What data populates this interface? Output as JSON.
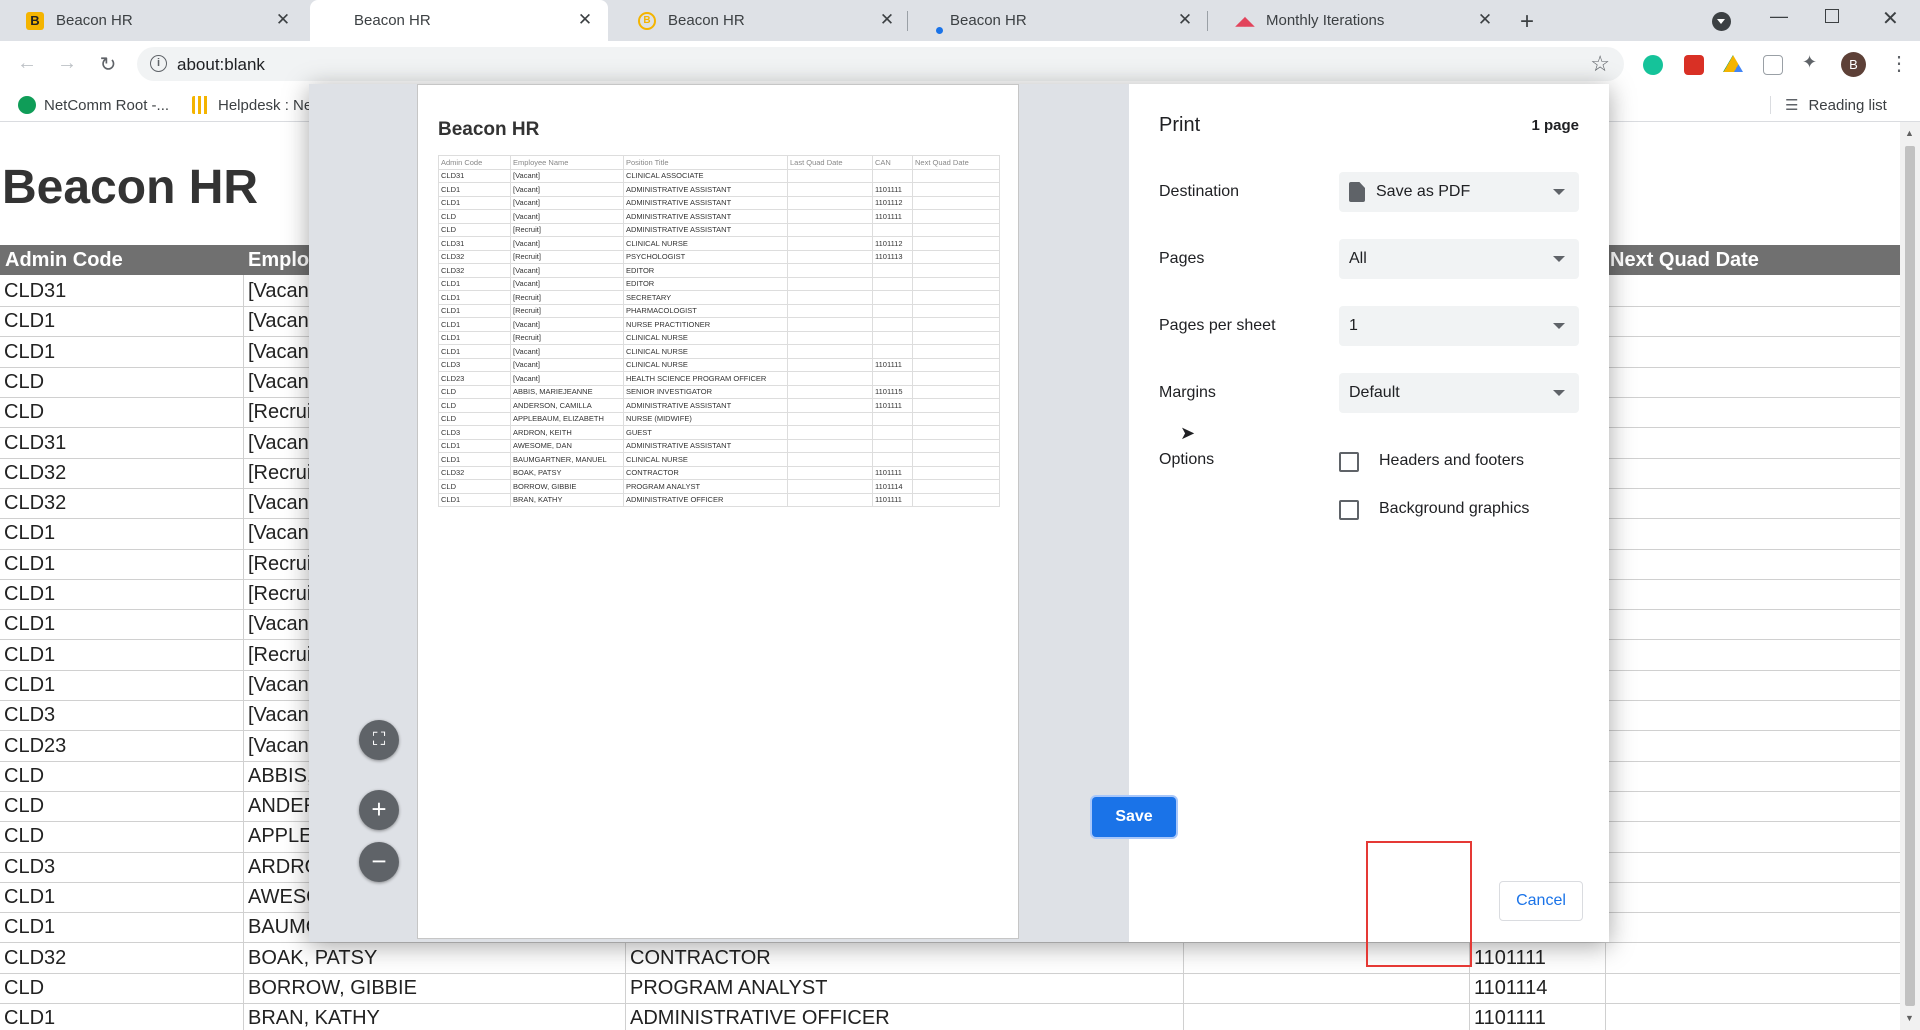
{
  "tabs": [
    {
      "title": "Beacon HR",
      "favicon": "B"
    },
    {
      "title": "Beacon HR",
      "favicon": ""
    },
    {
      "title": "Beacon HR",
      "favicon": "B"
    },
    {
      "title": "Beacon HR",
      "favicon": ""
    },
    {
      "title": "Monthly Iterations",
      "favicon": "M"
    }
  ],
  "address": {
    "url": "about:blank"
  },
  "bookmarks": [
    {
      "label": "NetComm Root -..."
    },
    {
      "label": "Helpdesk : Ne"
    }
  ],
  "reading_list": "Reading list",
  "profile_initial": "B",
  "page": {
    "title": "Beacon HR",
    "columns": [
      "Admin Code",
      "Employ",
      "Next Quad Date"
    ],
    "rows": [
      {
        "code": "CLD31",
        "name": "[Vacan",
        "title": "",
        "can": ""
      },
      {
        "code": "CLD1",
        "name": "[Vacan",
        "title": "",
        "can": ""
      },
      {
        "code": "CLD1",
        "name": "[Vacan",
        "title": "",
        "can": ""
      },
      {
        "code": "CLD",
        "name": "[Vacan",
        "title": "",
        "can": ""
      },
      {
        "code": "CLD",
        "name": "[Recrui",
        "title": "",
        "can": ""
      },
      {
        "code": "CLD31",
        "name": "[Vacan",
        "title": "",
        "can": ""
      },
      {
        "code": "CLD32",
        "name": "[Recrui",
        "title": "",
        "can": ""
      },
      {
        "code": "CLD32",
        "name": "[Vacan",
        "title": "",
        "can": ""
      },
      {
        "code": "CLD1",
        "name": "[Vacan",
        "title": "",
        "can": ""
      },
      {
        "code": "CLD1",
        "name": "[Recrui",
        "title": "",
        "can": ""
      },
      {
        "code": "CLD1",
        "name": "[Recrui",
        "title": "",
        "can": ""
      },
      {
        "code": "CLD1",
        "name": "[Vacan",
        "title": "",
        "can": ""
      },
      {
        "code": "CLD1",
        "name": "[Recrui",
        "title": "",
        "can": ""
      },
      {
        "code": "CLD1",
        "name": "[Vacan",
        "title": "",
        "can": ""
      },
      {
        "code": "CLD3",
        "name": "[Vacan",
        "title": "",
        "can": ""
      },
      {
        "code": "CLD23",
        "name": "[Vacan",
        "title": "",
        "can": ""
      },
      {
        "code": "CLD",
        "name": "ABBIS,",
        "title": "",
        "can": ""
      },
      {
        "code": "CLD",
        "name": "ANDER",
        "title": "",
        "can": ""
      },
      {
        "code": "CLD",
        "name": "APPLE",
        "title": "",
        "can": ""
      },
      {
        "code": "CLD3",
        "name": "ARDRO",
        "title": "",
        "can": ""
      },
      {
        "code": "CLD1",
        "name": "AWESC",
        "title": "",
        "can": ""
      },
      {
        "code": "CLD1",
        "name": "BAUMC",
        "title": "",
        "can": ""
      },
      {
        "code": "CLD32",
        "name": "BOAK, PATSY",
        "title": "CONTRACTOR",
        "can": "1101111"
      },
      {
        "code": "CLD",
        "name": "BORROW, GIBBIE",
        "title": "PROGRAM ANALYST",
        "can": "1101114"
      },
      {
        "code": "CLD1",
        "name": "BRAN, KATHY",
        "title": "ADMINISTRATIVE OFFICER",
        "can": "1101111"
      }
    ]
  },
  "preview": {
    "title": "Beacon HR",
    "headers": [
      "Admin Code",
      "Employee Name",
      "Position Title",
      "Last Quad Date",
      "CAN",
      "Next Quad Date"
    ],
    "rows": [
      [
        "CLD31",
        "[Vacant]",
        "CLINICAL ASSOCIATE",
        "",
        "",
        ""
      ],
      [
        "CLD1",
        "[Vacant]",
        "ADMINISTRATIVE ASSISTANT",
        "",
        "1101111",
        ""
      ],
      [
        "CLD1",
        "[Vacant]",
        "ADMINISTRATIVE ASSISTANT",
        "",
        "1101112",
        ""
      ],
      [
        "CLD",
        "[Vacant]",
        "ADMINISTRATIVE ASSISTANT",
        "",
        "1101111",
        ""
      ],
      [
        "CLD",
        "[Recruit]",
        "ADMINISTRATIVE ASSISTANT",
        "",
        "",
        ""
      ],
      [
        "CLD31",
        "[Vacant]",
        "CLINICAL NURSE",
        "",
        "1101112",
        ""
      ],
      [
        "CLD32",
        "[Recruit]",
        "PSYCHOLOGIST",
        "",
        "1101113",
        ""
      ],
      [
        "CLD32",
        "[Vacant]",
        "EDITOR",
        "",
        "",
        ""
      ],
      [
        "CLD1",
        "[Vacant]",
        "EDITOR",
        "",
        "",
        ""
      ],
      [
        "CLD1",
        "[Recruit]",
        "SECRETARY",
        "",
        "",
        ""
      ],
      [
        "CLD1",
        "[Recruit]",
        "PHARMACOLOGIST",
        "",
        "",
        ""
      ],
      [
        "CLD1",
        "[Vacant]",
        "NURSE PRACTITIONER",
        "",
        "",
        ""
      ],
      [
        "CLD1",
        "[Recruit]",
        "CLINICAL NURSE",
        "",
        "",
        ""
      ],
      [
        "CLD1",
        "[Vacant]",
        "CLINICAL NURSE",
        "",
        "",
        ""
      ],
      [
        "CLD3",
        "[Vacant]",
        "CLINICAL NURSE",
        "",
        "1101111",
        ""
      ],
      [
        "CLD23",
        "[Vacant]",
        "HEALTH SCIENCE PROGRAM OFFICER",
        "",
        "",
        ""
      ],
      [
        "CLD",
        "ABBIS, MARIEJEANNE",
        "SENIOR INVESTIGATOR",
        "",
        "1101115",
        ""
      ],
      [
        "CLD",
        "ANDERSON, CAMILLA",
        "ADMINISTRATIVE ASSISTANT",
        "",
        "1101111",
        ""
      ],
      [
        "CLD",
        "APPLEBAUM, ELIZABETH",
        "NURSE (MIDWIFE)",
        "",
        "",
        ""
      ],
      [
        "CLD3",
        "ARDRON, KEITH",
        "GUEST",
        "",
        "",
        ""
      ],
      [
        "CLD1",
        "AWESOME, DAN",
        "ADMINISTRATIVE ASSISTANT",
        "",
        "",
        ""
      ],
      [
        "CLD1",
        "BAUMGARTNER, MANUEL",
        "CLINICAL NURSE",
        "",
        "",
        ""
      ],
      [
        "CLD32",
        "BOAK, PATSY",
        "CONTRACTOR",
        "",
        "1101111",
        ""
      ],
      [
        "CLD",
        "BORROW, GIBBIE",
        "PROGRAM ANALYST",
        "",
        "1101114",
        ""
      ],
      [
        "CLD1",
        "BRAN, KATHY",
        "ADMINISTRATIVE OFFICER",
        "",
        "1101111",
        ""
      ]
    ]
  },
  "print": {
    "title": "Print",
    "page_count": "1 page",
    "destination_label": "Destination",
    "destination_value": "Save as PDF",
    "pages_label": "Pages",
    "pages_value": "All",
    "pps_label": "Pages per sheet",
    "pps_value": "1",
    "margins_label": "Margins",
    "margins_value": "Default",
    "options_label": "Options",
    "headers_footers": "Headers and footers",
    "background_graphics": "Background graphics",
    "save": "Save",
    "cancel": "Cancel"
  },
  "colors": {
    "accent": "#1a73e8",
    "highlight": "#e53935",
    "table_header": "#707070"
  }
}
